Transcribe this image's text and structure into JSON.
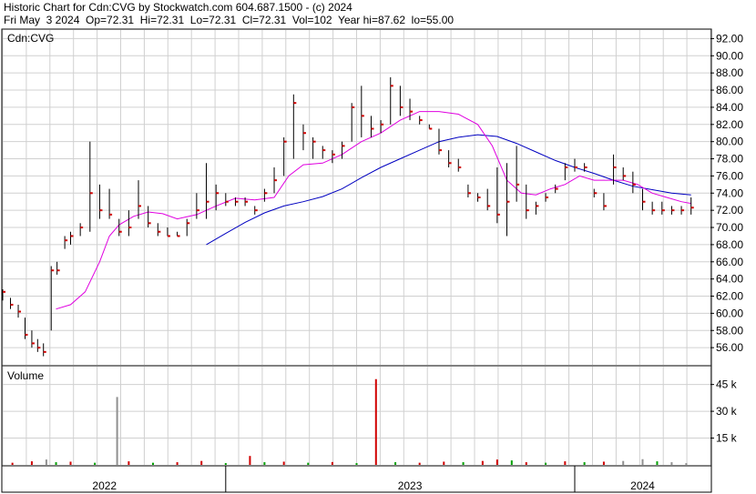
{
  "header": {
    "line1": "Historic Chart for Cdn:CVG by Stockwatch.com 604.687.1500 - (c) 2024",
    "line2": "Fri May  3 2024  Op=72.31  Hi=72.31  Lo=72.31  Cl=72.31  Vol=102  Year hi=87.62  lo=55.00"
  },
  "chart_data": [
    {
      "type": "line",
      "panel_label": "Cdn:CVG",
      "ylim": [
        54,
        93
      ],
      "y_ticks": [
        "92.00",
        "90.00",
        "88.00",
        "86.00",
        "84.00",
        "82.00",
        "80.00",
        "78.00",
        "76.00",
        "74.00",
        "72.00",
        "70.00",
        "68.00",
        "66.00",
        "64.00",
        "62.00",
        "60.00",
        "58.00",
        "56.00"
      ],
      "x_labels": [
        "2022",
        "2023",
        "2024"
      ],
      "grid": true,
      "colors": {
        "price_bar": "#000000",
        "close_tick": "#d00000",
        "ma_short": "#e000e0",
        "ma_long": "#0000c0"
      },
      "price_bars": [
        {
          "x": 0.0,
          "hi": 62.8,
          "lo": 61.5,
          "cl": 62.5
        },
        {
          "x": 0.8,
          "hi": 61.8,
          "lo": 60.5,
          "cl": 61.0
        },
        {
          "x": 1.6,
          "hi": 61.0,
          "lo": 59.5,
          "cl": 60.2
        },
        {
          "x": 2.3,
          "hi": 59.5,
          "lo": 57.0,
          "cl": 57.5
        },
        {
          "x": 3.0,
          "hi": 58.0,
          "lo": 56.0,
          "cl": 56.5
        },
        {
          "x": 3.6,
          "hi": 57.0,
          "lo": 55.5,
          "cl": 56.0
        },
        {
          "x": 4.2,
          "hi": 56.5,
          "lo": 55.0,
          "cl": 55.5
        },
        {
          "x": 5.0,
          "hi": 65.5,
          "lo": 58.0,
          "cl": 65.0
        },
        {
          "x": 5.6,
          "hi": 66.0,
          "lo": 64.5,
          "cl": 65.0
        },
        {
          "x": 6.4,
          "hi": 69.0,
          "lo": 67.5,
          "cl": 68.5
        },
        {
          "x": 7.0,
          "hi": 69.5,
          "lo": 68.0,
          "cl": 69.0
        },
        {
          "x": 8.0,
          "hi": 70.5,
          "lo": 69.0,
          "cl": 70.0
        },
        {
          "x": 9.0,
          "hi": 80.0,
          "lo": 69.5,
          "cl": 74.0
        },
        {
          "x": 10.0,
          "hi": 75.0,
          "lo": 71.0,
          "cl": 72.0
        },
        {
          "x": 11.0,
          "hi": 74.5,
          "lo": 71.0,
          "cl": 71.5
        },
        {
          "x": 12.0,
          "hi": 71.0,
          "lo": 69.0,
          "cl": 69.5
        },
        {
          "x": 13.0,
          "hi": 72.0,
          "lo": 69.0,
          "cl": 70.0
        },
        {
          "x": 14.0,
          "hi": 75.5,
          "lo": 71.0,
          "cl": 72.5
        },
        {
          "x": 15.0,
          "hi": 72.5,
          "lo": 70.0,
          "cl": 70.5
        },
        {
          "x": 16.0,
          "hi": 70.5,
          "lo": 69.0,
          "cl": 69.5
        },
        {
          "x": 17.0,
          "hi": 70.0,
          "lo": 69.0,
          "cl": 69.0
        },
        {
          "x": 18.0,
          "hi": 69.5,
          "lo": 69.0,
          "cl": 69.0
        },
        {
          "x": 19.0,
          "hi": 71.0,
          "lo": 69.0,
          "cl": 70.5
        },
        {
          "x": 20.0,
          "hi": 74.0,
          "lo": 71.0,
          "cl": 72.0
        },
        {
          "x": 21.0,
          "hi": 77.5,
          "lo": 71.0,
          "cl": 73.0
        },
        {
          "x": 22.0,
          "hi": 75.0,
          "lo": 72.0,
          "cl": 74.0
        },
        {
          "x": 23.0,
          "hi": 74.0,
          "lo": 72.5,
          "cl": 73.0
        },
        {
          "x": 24.0,
          "hi": 73.5,
          "lo": 72.5,
          "cl": 73.0
        },
        {
          "x": 25.0,
          "hi": 73.5,
          "lo": 72.5,
          "cl": 73.0
        },
        {
          "x": 26.0,
          "hi": 72.5,
          "lo": 71.5,
          "cl": 72.0
        },
        {
          "x": 27.0,
          "hi": 74.5,
          "lo": 73.0,
          "cl": 74.0
        },
        {
          "x": 28.0,
          "hi": 77.0,
          "lo": 74.0,
          "cl": 75.5
        },
        {
          "x": 29.0,
          "hi": 80.5,
          "lo": 76.0,
          "cl": 80.0
        },
        {
          "x": 30.0,
          "hi": 85.5,
          "lo": 78.0,
          "cl": 84.5
        },
        {
          "x": 31.0,
          "hi": 82.0,
          "lo": 79.0,
          "cl": 81.0
        },
        {
          "x": 32.0,
          "hi": 80.5,
          "lo": 78.0,
          "cl": 80.0
        },
        {
          "x": 33.0,
          "hi": 79.5,
          "lo": 78.0,
          "cl": 79.0
        },
        {
          "x": 34.0,
          "hi": 79.0,
          "lo": 77.5,
          "cl": 78.5
        },
        {
          "x": 35.0,
          "hi": 80.0,
          "lo": 78.0,
          "cl": 79.5
        },
        {
          "x": 36.0,
          "hi": 84.5,
          "lo": 80.0,
          "cl": 84.0
        },
        {
          "x": 37.0,
          "hi": 86.5,
          "lo": 80.5,
          "cl": 83.0
        },
        {
          "x": 38.0,
          "hi": 83.0,
          "lo": 80.5,
          "cl": 81.5
        },
        {
          "x": 39.0,
          "hi": 82.5,
          "lo": 81.0,
          "cl": 82.0
        },
        {
          "x": 40.0,
          "hi": 87.5,
          "lo": 82.0,
          "cl": 86.5
        },
        {
          "x": 41.0,
          "hi": 86.5,
          "lo": 83.0,
          "cl": 84.0
        },
        {
          "x": 42.0,
          "hi": 85.0,
          "lo": 82.5,
          "cl": 83.5
        },
        {
          "x": 43.0,
          "hi": 83.0,
          "lo": 82.0,
          "cl": 82.5
        },
        {
          "x": 44.0,
          "hi": 82.0,
          "lo": 81.5,
          "cl": 81.5
        },
        {
          "x": 45.0,
          "hi": 81.5,
          "lo": 78.5,
          "cl": 79.0
        },
        {
          "x": 46.0,
          "hi": 79.0,
          "lo": 77.0,
          "cl": 77.5
        },
        {
          "x": 47.0,
          "hi": 78.0,
          "lo": 76.5,
          "cl": 77.0
        },
        {
          "x": 48.0,
          "hi": 75.0,
          "lo": 73.5,
          "cl": 74.0
        },
        {
          "x": 49.0,
          "hi": 74.0,
          "lo": 73.0,
          "cl": 73.5
        },
        {
          "x": 50.0,
          "hi": 74.5,
          "lo": 72.0,
          "cl": 72.5
        },
        {
          "x": 51.0,
          "hi": 77.0,
          "lo": 70.5,
          "cl": 71.5
        },
        {
          "x": 52.0,
          "hi": 77.5,
          "lo": 69.0,
          "cl": 73.0
        },
        {
          "x": 53.0,
          "hi": 79.5,
          "lo": 73.0,
          "cl": 75.0
        },
        {
          "x": 54.0,
          "hi": 75.0,
          "lo": 71.0,
          "cl": 72.0
        },
        {
          "x": 55.0,
          "hi": 73.0,
          "lo": 71.5,
          "cl": 72.5
        },
        {
          "x": 56.0,
          "hi": 74.0,
          "lo": 73.0,
          "cl": 73.5
        },
        {
          "x": 57.0,
          "hi": 75.0,
          "lo": 74.0,
          "cl": 74.5
        },
        {
          "x": 58.0,
          "hi": 77.5,
          "lo": 75.5,
          "cl": 77.0
        },
        {
          "x": 59.0,
          "hi": 78.0,
          "lo": 76.5,
          "cl": 77.0
        },
        {
          "x": 60.0,
          "hi": 77.5,
          "lo": 76.5,
          "cl": 77.0
        },
        {
          "x": 61.0,
          "hi": 74.5,
          "lo": 73.5,
          "cl": 74.0
        },
        {
          "x": 62.0,
          "hi": 74.0,
          "lo": 72.0,
          "cl": 72.5
        },
        {
          "x": 63.0,
          "hi": 78.5,
          "lo": 75.0,
          "cl": 77.0
        },
        {
          "x": 64.0,
          "hi": 77.0,
          "lo": 75.5,
          "cl": 76.0
        },
        {
          "x": 65.0,
          "hi": 76.5,
          "lo": 74.0,
          "cl": 75.0
        },
        {
          "x": 66.0,
          "hi": 74.5,
          "lo": 72.0,
          "cl": 73.0
        },
        {
          "x": 67.0,
          "hi": 73.0,
          "lo": 71.5,
          "cl": 72.0
        },
        {
          "x": 68.0,
          "hi": 73.0,
          "lo": 71.5,
          "cl": 72.0
        },
        {
          "x": 69.0,
          "hi": 72.5,
          "lo": 71.5,
          "cl": 72.0
        },
        {
          "x": 70.0,
          "hi": 72.5,
          "lo": 71.5,
          "cl": 72.0
        },
        {
          "x": 71.0,
          "hi": 73.5,
          "lo": 71.5,
          "cl": 72.31
        }
      ],
      "ma_short": [
        {
          "x": 5.5,
          "y": 60.5
        },
        {
          "x": 7.0,
          "y": 61.0
        },
        {
          "x": 8.5,
          "y": 62.5
        },
        {
          "x": 10.0,
          "y": 66.0
        },
        {
          "x": 11.0,
          "y": 69.0
        },
        {
          "x": 12.0,
          "y": 70.3
        },
        {
          "x": 13.5,
          "y": 71.3
        },
        {
          "x": 15.0,
          "y": 71.8
        },
        {
          "x": 16.5,
          "y": 71.6
        },
        {
          "x": 18.0,
          "y": 71.0
        },
        {
          "x": 20.0,
          "y": 71.5
        },
        {
          "x": 22.0,
          "y": 72.5
        },
        {
          "x": 24.0,
          "y": 73.4
        },
        {
          "x": 26.0,
          "y": 73.2
        },
        {
          "x": 28.0,
          "y": 73.5
        },
        {
          "x": 29.5,
          "y": 76.0
        },
        {
          "x": 31.0,
          "y": 77.3
        },
        {
          "x": 33.0,
          "y": 77.5
        },
        {
          "x": 35.0,
          "y": 78.5
        },
        {
          "x": 37.0,
          "y": 80.0
        },
        {
          "x": 39.0,
          "y": 81.0
        },
        {
          "x": 41.0,
          "y": 82.5
        },
        {
          "x": 43.0,
          "y": 83.5
        },
        {
          "x": 45.0,
          "y": 83.5
        },
        {
          "x": 47.0,
          "y": 83.2
        },
        {
          "x": 49.0,
          "y": 82.0
        },
        {
          "x": 50.5,
          "y": 79.5
        },
        {
          "x": 52.0,
          "y": 75.5
        },
        {
          "x": 53.5,
          "y": 74.0
        },
        {
          "x": 55.0,
          "y": 73.8
        },
        {
          "x": 56.5,
          "y": 74.5
        },
        {
          "x": 58.0,
          "y": 75.0
        },
        {
          "x": 59.5,
          "y": 76.0
        },
        {
          "x": 61.0,
          "y": 75.5
        },
        {
          "x": 62.5,
          "y": 75.5
        },
        {
          "x": 64.0,
          "y": 75.5
        },
        {
          "x": 65.5,
          "y": 75.0
        },
        {
          "x": 67.0,
          "y": 74.0
        },
        {
          "x": 68.5,
          "y": 73.5
        },
        {
          "x": 70.0,
          "y": 73.0
        },
        {
          "x": 71.0,
          "y": 72.8
        }
      ],
      "ma_long": [
        {
          "x": 21.0,
          "y": 68.0
        },
        {
          "x": 23.0,
          "y": 69.3
        },
        {
          "x": 25.0,
          "y": 70.6
        },
        {
          "x": 27.0,
          "y": 71.7
        },
        {
          "x": 29.0,
          "y": 72.5
        },
        {
          "x": 31.0,
          "y": 73.0
        },
        {
          "x": 33.0,
          "y": 73.6
        },
        {
          "x": 35.0,
          "y": 74.5
        },
        {
          "x": 37.0,
          "y": 75.8
        },
        {
          "x": 39.0,
          "y": 77.0
        },
        {
          "x": 41.0,
          "y": 78.0
        },
        {
          "x": 43.0,
          "y": 79.0
        },
        {
          "x": 45.0,
          "y": 80.0
        },
        {
          "x": 47.0,
          "y": 80.5
        },
        {
          "x": 49.0,
          "y": 80.8
        },
        {
          "x": 51.0,
          "y": 80.6
        },
        {
          "x": 53.0,
          "y": 79.8
        },
        {
          "x": 55.0,
          "y": 78.8
        },
        {
          "x": 57.0,
          "y": 77.8
        },
        {
          "x": 59.0,
          "y": 77.0
        },
        {
          "x": 61.0,
          "y": 76.3
        },
        {
          "x": 63.0,
          "y": 75.5
        },
        {
          "x": 65.0,
          "y": 74.8
        },
        {
          "x": 67.0,
          "y": 74.4
        },
        {
          "x": 69.0,
          "y": 74.0
        },
        {
          "x": 71.0,
          "y": 73.8
        }
      ]
    },
    {
      "type": "bar",
      "panel_label": "Volume",
      "ylim": [
        0,
        55
      ],
      "y_ticks": [
        "45 k",
        "30 k",
        "15 k"
      ],
      "y_tick_values": [
        45,
        30,
        15
      ],
      "unit": "thousand shares",
      "colors": {
        "up": "#00a000",
        "down": "#d00000",
        "neutral": "#909090"
      },
      "bars": [
        {
          "x": 1.0,
          "v": 1.2,
          "c": "down"
        },
        {
          "x": 3.0,
          "v": 2.0,
          "c": "down"
        },
        {
          "x": 4.5,
          "v": 3.0,
          "c": "neutral"
        },
        {
          "x": 5.5,
          "v": 1.5,
          "c": "up"
        },
        {
          "x": 7.0,
          "v": 1.8,
          "c": "down"
        },
        {
          "x": 9.5,
          "v": 1.2,
          "c": "up"
        },
        {
          "x": 11.8,
          "v": 38.0,
          "c": "neutral"
        },
        {
          "x": 13.0,
          "v": 2.0,
          "c": "down"
        },
        {
          "x": 15.5,
          "v": 1.2,
          "c": "up"
        },
        {
          "x": 18.0,
          "v": 1.5,
          "c": "down"
        },
        {
          "x": 20.5,
          "v": 2.2,
          "c": "down"
        },
        {
          "x": 23.0,
          "v": 1.0,
          "c": "up"
        },
        {
          "x": 25.5,
          "v": 5.0,
          "c": "down"
        },
        {
          "x": 27.0,
          "v": 1.5,
          "c": "up"
        },
        {
          "x": 29.0,
          "v": 1.8,
          "c": "down"
        },
        {
          "x": 31.5,
          "v": 1.2,
          "c": "up"
        },
        {
          "x": 34.0,
          "v": 1.6,
          "c": "down"
        },
        {
          "x": 36.5,
          "v": 1.0,
          "c": "up"
        },
        {
          "x": 38.5,
          "v": 48.0,
          "c": "down"
        },
        {
          "x": 40.5,
          "v": 1.5,
          "c": "up"
        },
        {
          "x": 43.0,
          "v": 1.2,
          "c": "down"
        },
        {
          "x": 45.5,
          "v": 1.8,
          "c": "down"
        },
        {
          "x": 47.5,
          "v": 1.5,
          "c": "up"
        },
        {
          "x": 49.5,
          "v": 2.2,
          "c": "down"
        },
        {
          "x": 51.0,
          "v": 3.0,
          "c": "down"
        },
        {
          "x": 52.5,
          "v": 2.5,
          "c": "up"
        },
        {
          "x": 54.0,
          "v": 1.5,
          "c": "down"
        },
        {
          "x": 56.0,
          "v": 1.2,
          "c": "up"
        },
        {
          "x": 58.0,
          "v": 2.0,
          "c": "down"
        },
        {
          "x": 60.0,
          "v": 1.5,
          "c": "up"
        },
        {
          "x": 62.0,
          "v": 1.8,
          "c": "down"
        },
        {
          "x": 64.0,
          "v": 2.2,
          "c": "neutral"
        },
        {
          "x": 66.0,
          "v": 3.2,
          "c": "neutral"
        },
        {
          "x": 67.5,
          "v": 2.0,
          "c": "up"
        },
        {
          "x": 69.0,
          "v": 1.5,
          "c": "neutral"
        },
        {
          "x": 70.5,
          "v": 1.0,
          "c": "neutral"
        }
      ]
    }
  ]
}
